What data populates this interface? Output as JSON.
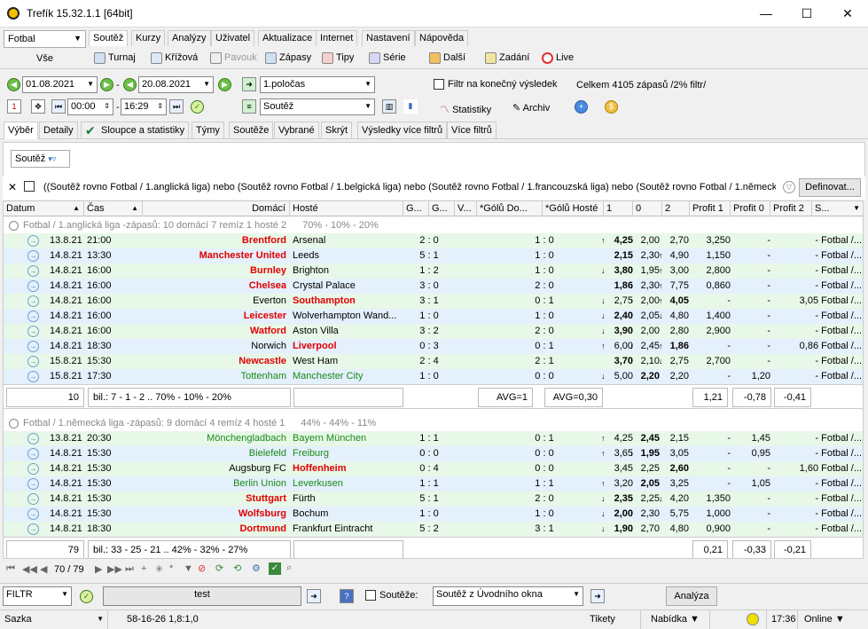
{
  "window": {
    "title": "Trefík 15.32.1.1 [64bit]",
    "min": "—",
    "max": "☐",
    "close": "✕"
  },
  "sport": "Fotbal",
  "vse": "Vše",
  "tabs": [
    "Soutěž",
    "Kurzy",
    "Analýzy",
    "Uživatel",
    "Aktualizace",
    "Internet",
    "Nastavení",
    "Nápověda"
  ],
  "toolbar": [
    "Turnaj",
    "Křížová",
    "Pavouk",
    "Zápasy",
    "Tipy",
    "Série",
    "Další",
    "Zadání",
    "Live"
  ],
  "date_from": "01.08.2021",
  "date_to": "20.08.2021",
  "dash": "-",
  "period": "1.poločas",
  "final_result_label": "Filtr na konečný výsledek",
  "total": "Celkem 4105 zápasů /2% filtr/",
  "time_from": "00:00",
  "time_to": "16:29",
  "sout_sel": "Soutěž",
  "statistiky": "Statistiky",
  "archiv": "Archiv",
  "subtabs": [
    "Výběr",
    "Detaily",
    "Sloupce a statistiky",
    "Týmy",
    "Soutěže",
    "Vybrané",
    "Skrýt",
    "Výsledky více filtrů",
    "Více filtrů"
  ],
  "sout_filter": "Soutěž",
  "filter_text": "((Soutěž rovno Fotbal / 1.anglická liga) nebo (Soutěž rovno Fotbal / 1.belgická liga) nebo (Soutěž rovno Fotbal / 1.francouzská liga) nebo (Soutěž rovno Fotbal / 1.německá",
  "definovat": "Definovat...",
  "columns": [
    "Datum",
    "Čas",
    "Domácí",
    "Hosté",
    "G...",
    "G...",
    "V...",
    "*Gólů Do...",
    "*Gólů Hosté",
    "1",
    "0",
    "2",
    "Profit 1",
    "Profit 0",
    "Profit 2",
    "S..."
  ],
  "groups": [
    {
      "title": "Fotbal / 1.anglická liga -zápasů: 10  domácí 7  remíz 1  hosté 2",
      "pct": "70% - 10% - 20%",
      "rows": [
        [
          "13.8.21",
          "21:00",
          "Brentford",
          "Arsenal",
          "2 : 0",
          "1 : 0",
          "4,25",
          "2,00",
          "2,70",
          "3,250",
          "-",
          "- Fotbal /...",
          "g",
          "h",
          "up",
          "",
          ""
        ],
        [
          "14.8.21",
          "13:30",
          "Manchester United",
          "Leeds",
          "5 : 1",
          "1 : 0",
          "2,15",
          "2,30",
          "4,90",
          "1,150",
          "-",
          "- Fotbal /...",
          "b",
          "h",
          "",
          "up",
          "up"
        ],
        [
          "14.8.21",
          "16:00",
          "Burnley",
          "Brighton",
          "1 : 2",
          "1 : 0",
          "3,80",
          "1,95",
          "3,00",
          "2,800",
          "-",
          "- Fotbal /...",
          "g",
          "h",
          "dn",
          "up",
          "up"
        ],
        [
          "14.8.21",
          "16:00",
          "Chelsea",
          "Crystal Palace",
          "3 : 0",
          "2 : 0",
          "1,86",
          "2,30",
          "7,75",
          "0,860",
          "-",
          "- Fotbal /...",
          "b",
          "h",
          "",
          "dn",
          "up"
        ],
        [
          "14.8.21",
          "16:00",
          "Everton",
          "Southampton",
          "3 : 1",
          "0 : 1",
          "2,75",
          "2,00",
          "4,05",
          "-",
          "-",
          "3,05 Fotbal /...",
          "g",
          "a",
          "dn",
          "up",
          "up"
        ],
        [
          "14.8.21",
          "16:00",
          "Leicester",
          "Wolverhampton Wand...",
          "1 : 0",
          "1 : 0",
          "2,40",
          "2,05",
          "4,80",
          "1,400",
          "-",
          "- Fotbal /...",
          "b",
          "h",
          "dn",
          "up",
          "dn"
        ],
        [
          "14.8.21",
          "16:00",
          "Watford",
          "Aston Villa",
          "3 : 2",
          "2 : 0",
          "3,90",
          "2,00",
          "2,80",
          "2,900",
          "-",
          "- Fotbal /...",
          "g",
          "h",
          "dn",
          "up",
          ""
        ],
        [
          "14.8.21",
          "18:30",
          "Norwich",
          "Liverpool",
          "0 : 3",
          "0 : 1",
          "6,00",
          "2,45",
          "1,86",
          "-",
          "-",
          "0,86 Fotbal /...",
          "b",
          "a",
          "up",
          "dn",
          "up"
        ],
        [
          "15.8.21",
          "15:30",
          "Newcastle",
          "West Ham",
          "2 : 4",
          "2 : 1",
          "3,70",
          "2,10",
          "2,75",
          "2,700",
          "-",
          "- Fotbal /...",
          "g",
          "h",
          "",
          "up",
          "dn"
        ],
        [
          "15.8.21",
          "17:30",
          "Tottenham",
          "Manchester City",
          "1 : 0",
          "0 : 0",
          "5,00",
          "2,20",
          "2,20",
          "-",
          "1,20",
          "- Fotbal /...",
          "b",
          "n",
          "dn",
          "",
          ""
        ]
      ],
      "sum": {
        "count": "10",
        "bil": "bil.: 7 - 1 - 2 .. 70% - 10% - 20%",
        "avg1": "AVG=1",
        "avg2": "AVG=0,30",
        "p1": "1,21",
        "p0": "-0,78",
        "p2": "-0,41"
      }
    },
    {
      "title": "Fotbal / 1.německá liga -zápasů: 9  domácí 4  remíz 4  hosté 1",
      "pct": "44% - 44% - 11%",
      "rows": [
        [
          "13.8.21",
          "20:30",
          "Mönchengladbach",
          "Bayern München",
          "1 : 1",
          "0 : 1",
          "4,25",
          "2,45",
          "2,15",
          "-",
          "1,45",
          "- Fotbal /...",
          "g",
          "n",
          "up",
          "",
          ""
        ],
        [
          "14.8.21",
          "15:30",
          "Bielefeld",
          "Freiburg",
          "0 : 0",
          "0 : 0",
          "3,65",
          "1,95",
          "3,05",
          "-",
          "0,95",
          "- Fotbal /...",
          "b",
          "n",
          "up",
          "dn",
          ""
        ],
        [
          "14.8.21",
          "15:30",
          "Augsburg FC",
          "Hoffenheim",
          "0 : 4",
          "0 : 0",
          "3,45",
          "2,25",
          "2,60",
          "-",
          "-",
          "1,60 Fotbal /...",
          "g",
          "a",
          "",
          "",
          ""
        ],
        [
          "14.8.21",
          "15:30",
          "Berlin Union",
          "Leverkusen",
          "1 : 1",
          "1 : 1",
          "3,20",
          "2,05",
          "3,25",
          "-",
          "1,05",
          "- Fotbal /...",
          "b",
          "n",
          "up",
          "",
          ""
        ],
        [
          "14.8.21",
          "15:30",
          "Stuttgart",
          "Fürth",
          "5 : 1",
          "2 : 0",
          "2,35",
          "2,25",
          "4,20",
          "1,350",
          "-",
          "- Fotbal /...",
          "g",
          "h",
          "dn",
          "up",
          "dn"
        ],
        [
          "14.8.21",
          "15:30",
          "Wolfsburg",
          "Bochum",
          "1 : 0",
          "1 : 0",
          "2,00",
          "2,30",
          "5,75",
          "1,000",
          "-",
          "- Fotbal /...",
          "b",
          "h",
          "dn",
          "up",
          ""
        ],
        [
          "14.8.21",
          "18:30",
          "Dortmund",
          "Frankfurt Eintracht",
          "5 : 2",
          "3 : 1",
          "1,90",
          "2,70",
          "4,80",
          "0,900",
          "-",
          "- Fotbal /...",
          "g",
          "h",
          "dn",
          "dn",
          ""
        ]
      ],
      "sum": {
        "count": "79",
        "bil": "bil.: 33 - 25 - 21 .. 42% - 32% - 27%",
        "p1": "0,21",
        "p0": "-0,33",
        "p2": "-0,21"
      }
    }
  ],
  "nav": "70 / 79",
  "filtr": "FILTR",
  "test": "test",
  "soutezecheck": "Soutěže:",
  "sout_uvod": "Soutěž z Úvodního okna",
  "analyza": "Analýza",
  "status": {
    "sazka": "Sazka",
    "code": "58-16-26  1,8:1,0",
    "tikety": "Tikety",
    "nabidka": "Nabídka ▼",
    "time": "17:36",
    "online": "Online ▼"
  }
}
